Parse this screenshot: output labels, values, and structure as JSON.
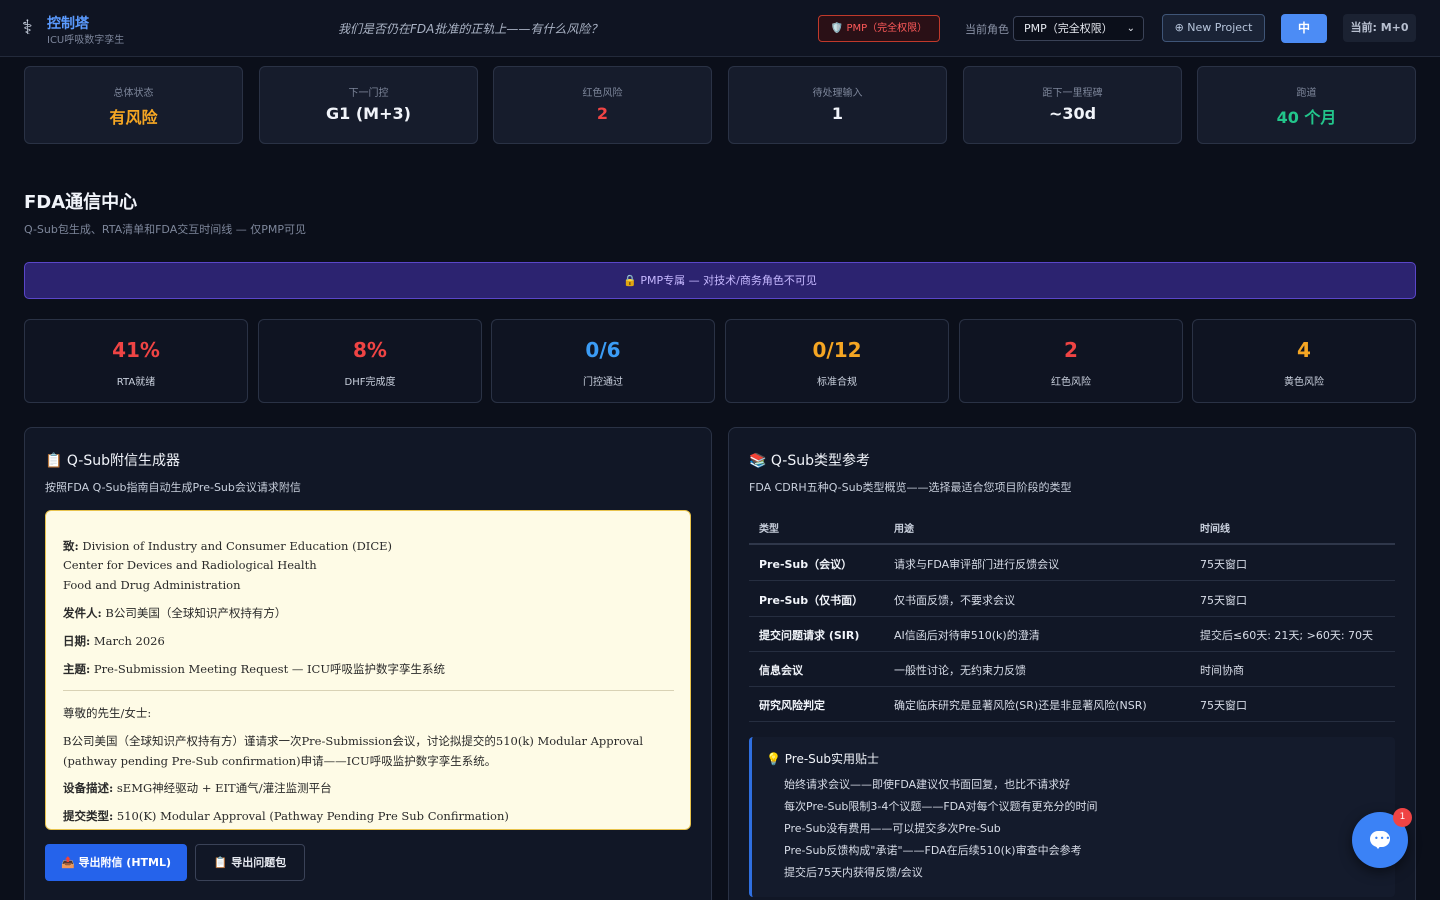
{
  "header": {
    "logo_icon": "caduceus-icon",
    "title": "控制塔",
    "subtitle": "ICU呼吸数字孪生",
    "tagline": "我们是否仍在FDA批准的正轨上——有什么风险？",
    "pmp_badge": "🛡️ PMP（完全权限）",
    "role_label": "当前角色",
    "role_value": "PMP（完全权限）",
    "new_project": "⊕ New Project",
    "lang": "中",
    "current": "当前: M+0"
  },
  "status_cards": [
    {
      "label": "总体状态",
      "value": "有风险",
      "color": "#f5a623"
    },
    {
      "label": "下一门控",
      "value": "G1 (M+3)",
      "color": "#f1f4fa"
    },
    {
      "label": "红色风险",
      "value": "2",
      "color": "#ef4444"
    },
    {
      "label": "待处理输入",
      "value": "1",
      "color": "#f1f4fa"
    },
    {
      "label": "距下一里程碑",
      "value": "~30d",
      "color": "#f1f4fa"
    },
    {
      "label": "跑道",
      "value": "40 个月",
      "color": "#22c58b"
    }
  ],
  "section": {
    "title": "FDA通信中心",
    "subtitle": "Q-Sub包生成、RTA清单和FDA交互时间线 — 仅PMP可见",
    "banner": "🔒 PMP专属 — 对技术/商务角色不可见"
  },
  "metrics": [
    {
      "value": "41%",
      "label": "RTA就绪",
      "color": "#ef4444"
    },
    {
      "value": "8%",
      "label": "DHF完成度",
      "color": "#ef4444"
    },
    {
      "value": "0/6",
      "label": "门控通过",
      "color": "#3b9cf5"
    },
    {
      "value": "0/12",
      "label": "标准合规",
      "color": "#f5a623"
    },
    {
      "value": "2",
      "label": "红色风险",
      "color": "#ef4444"
    },
    {
      "value": "4",
      "label": "黄色风险",
      "color": "#f5a623"
    }
  ],
  "generator": {
    "title": "📋 Q-Sub附信生成器",
    "subtitle": "按照FDA Q-Sub指南自动生成Pre-Sub会议请求附信",
    "letter": {
      "to_label": "致:",
      "to_line1": "Division of Industry and Consumer Education (DICE)",
      "to_line2": "Center for Devices and Radiological Health",
      "to_line3": "Food and Drug Administration",
      "from_label": "发件人:",
      "from_value": "B公司美国（全球知识产权持有方）",
      "date_label": "日期:",
      "date_value": "March 2026",
      "subject_label": "主题:",
      "subject_value": "Pre-Submission Meeting Request — ICU呼吸监护数字孪生系统",
      "greeting": "尊敬的先生/女士:",
      "body_line1": "B公司美国（全球知识产权持有方）谨请求一次Pre-Submission会议，讨论拟提交的510(k) Modular Approval",
      "body_line2": "(pathway pending Pre-Sub confirmation)申请——ICU呼吸监护数字孪生系统。",
      "device_label": "设备描述:",
      "device_value": "sEMG神经驱动 + EIT通气/灌注监测平台",
      "type_label": "提交类型:",
      "type_value": "510(K) Modular Approval (Pathway Pending Pre Sub Confirmation)"
    },
    "export_button": "📤 导出附信 (HTML)",
    "pack_button": "📋 导出问题包"
  },
  "reference": {
    "title": "📚 Q-Sub类型参考",
    "subtitle": "FDA CDRH五种Q-Sub类型概览——选择最适合您项目阶段的类型",
    "columns": [
      "类型",
      "用途",
      "时间线"
    ],
    "rows": [
      {
        "type": "Pre-Sub（会议）",
        "purpose": "请求与FDA审评部门进行反馈会议",
        "timeline": "75天窗口"
      },
      {
        "type": "Pre-Sub（仅书面）",
        "purpose": "仅书面反馈，不要求会议",
        "timeline": "75天窗口"
      },
      {
        "type": "提交问题请求 (SIR)",
        "purpose": "AI信函后对待审510(k)的澄清",
        "timeline": "提交后≤60天: 21天; >60天: 70天"
      },
      {
        "type": "信息会议",
        "purpose": "一般性讨论，无约束力反馈",
        "timeline": "时间协商"
      },
      {
        "type": "研究风险判定",
        "purpose": "确定临床研究是显著风险(SR)还是非显著风险(NSR)",
        "timeline": "75天窗口"
      }
    ],
    "tips_title": "💡 Pre-Sub实用贴士",
    "tips": [
      "始终请求会议——即使FDA建议仅书面回复，也比不请求好",
      "每次Pre-Sub限制3-4个议题——FDA对每个议题有更充分的时间",
      "Pre-Sub没有费用——可以提交多次Pre-Sub",
      "Pre-Sub反馈构成\"承诺\"——FDA在后续510(k)审查中会参考",
      "提交后75天内获得反馈/会议"
    ]
  },
  "chat": {
    "icon": "chat-icon",
    "badge": "1"
  }
}
